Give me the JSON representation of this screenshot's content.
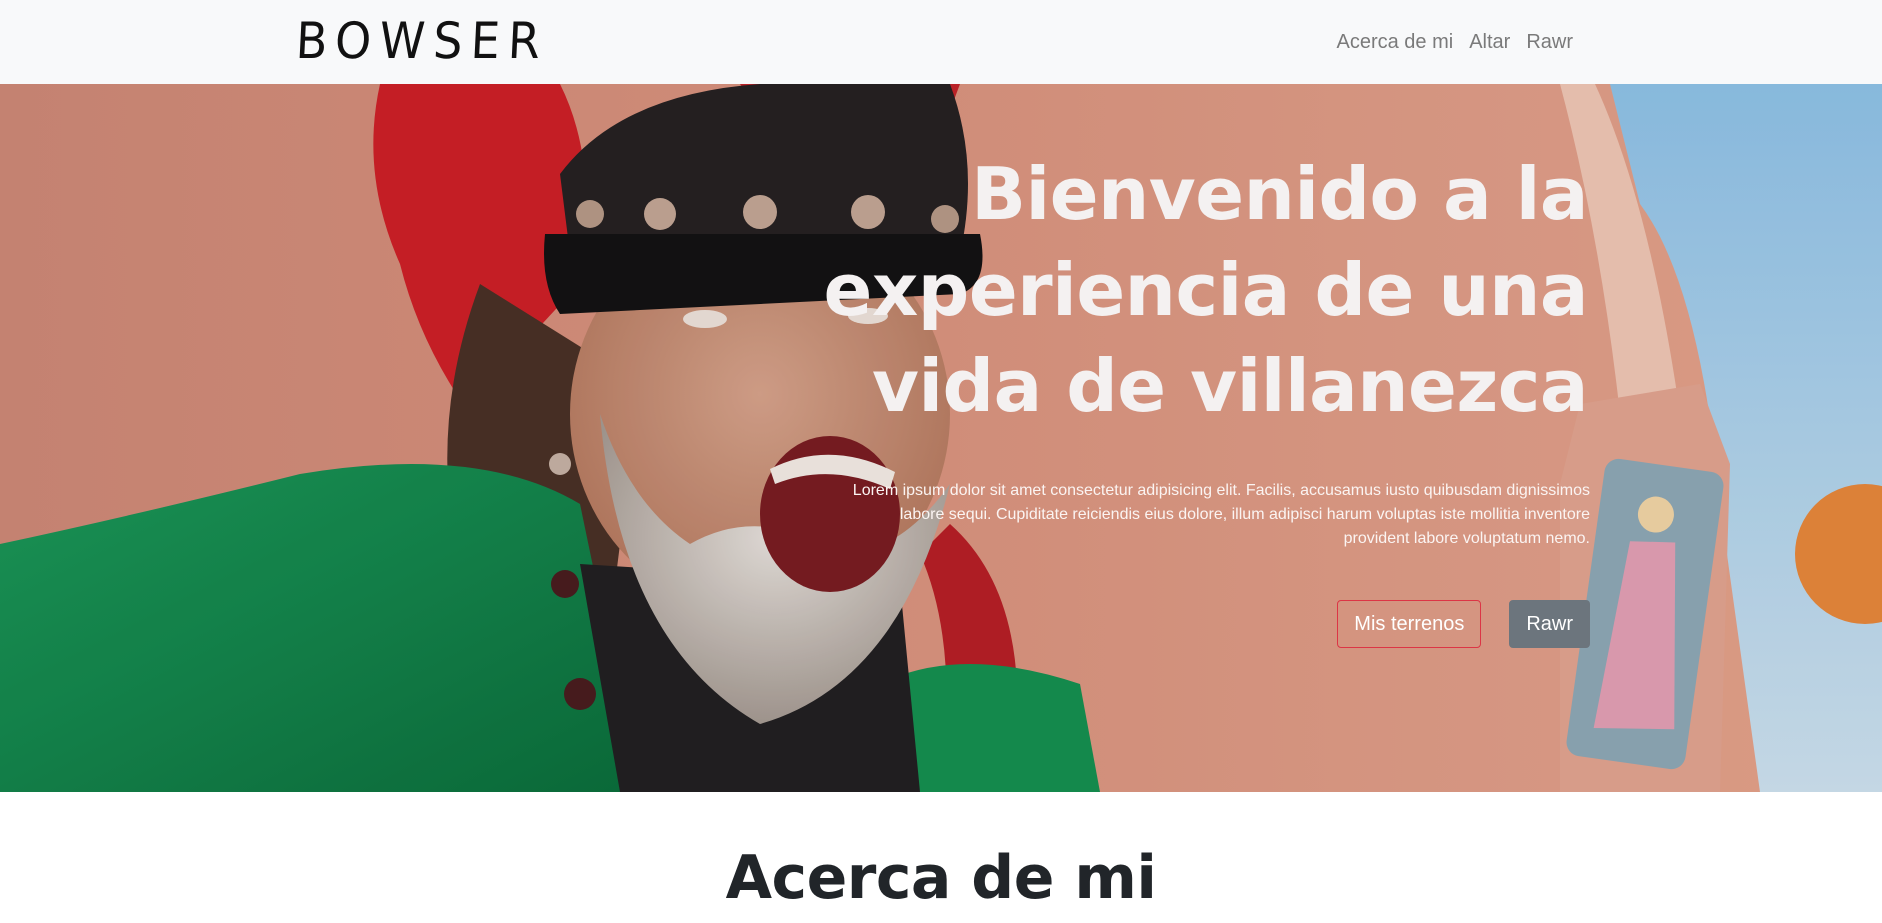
{
  "navbar": {
    "brand": "BOWSER",
    "links": [
      {
        "label": "Acerca de mi"
      },
      {
        "label": "Altar"
      },
      {
        "label": "Rawr"
      }
    ]
  },
  "hero": {
    "title_lines": [
      "Bienvenido a la",
      "experiencia de una",
      "vida de villanezca"
    ],
    "lead": "Lorem ipsum dolor sit amet consectetur adipisicing elit. Facilis, accusamus iusto quibusdam dignissimos labore sequi. Cupiditate reiciendis eius dolore, illum adipisci harum voluptas iste mollitia inventore provident labore voluptatum nemo.",
    "primary_button": "Mis terrenos",
    "secondary_button": "Rawr"
  },
  "about": {
    "title": "Acerca de mi"
  },
  "colors": {
    "navbar_bg": "#f8f9fa",
    "danger": "#dc3545",
    "secondary": "#6c757d",
    "text_dark": "#212529"
  },
  "icons": {
    "brand_logo": "bowser-wordmark"
  }
}
